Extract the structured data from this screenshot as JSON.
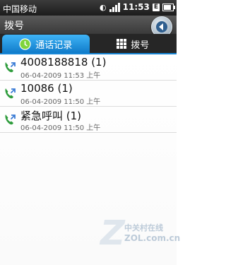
{
  "status_bar": {
    "carrier": "中国移动",
    "time": "11:53",
    "network_badge": "E"
  },
  "header": {
    "title": "拨号",
    "back_icon": "back-arrow-icon"
  },
  "tabs": [
    {
      "label": "通话记录",
      "icon": "call-log-icon",
      "active": true
    },
    {
      "label": "拨号",
      "icon": "dialpad-grid-icon",
      "active": false
    }
  ],
  "calls": [
    {
      "name": "4008188818 (1)",
      "time": "06-04-2009 11:53 上午",
      "icon": "outgoing-call-icon"
    },
    {
      "name": "10086 (1)",
      "time": "06-04-2009 11:50 上午",
      "icon": "outgoing-call-icon"
    },
    {
      "name": "紧急呼叫 (1)",
      "time": "06-04-2009 11:50 上午",
      "icon": "outgoing-call-icon"
    }
  ],
  "watermark": {
    "brand": "中关村在线",
    "url": "ZOL.com.cn"
  },
  "colors": {
    "accent": "#1887d6",
    "call_icon_green": "#34a853",
    "title_bar": "#4a4a4a"
  }
}
